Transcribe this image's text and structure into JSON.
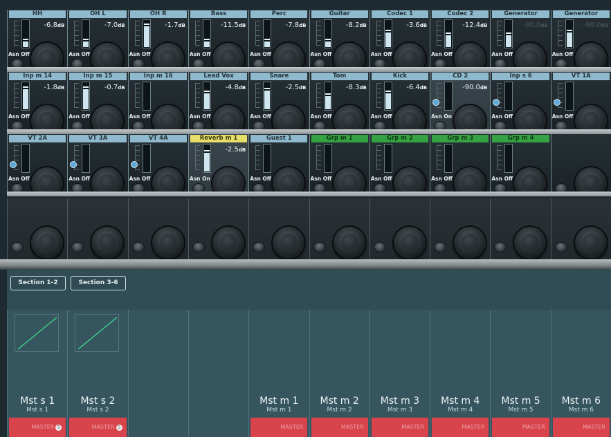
{
  "rows": [
    [
      {
        "name": "HH",
        "value": "-6.8",
        "unit": "dB",
        "asn": "Asn Off",
        "level": 0.22
      },
      {
        "name": "OH L",
        "value": "-7.0",
        "unit": "dB",
        "asn": "Asn Off",
        "level": 0.2
      },
      {
        "name": "OH R",
        "value": "-1.7",
        "unit": "dB",
        "asn": "Asn Off",
        "level": 0.8
      },
      {
        "name": "Bass",
        "value": "-11.5",
        "unit": "dB",
        "asn": "Asn Off",
        "level": 0.2
      },
      {
        "name": "Perc",
        "value": "-7.8",
        "unit": "dB",
        "asn": "Asn Off",
        "level": 0.2
      },
      {
        "name": "Guitar",
        "value": "-8.2",
        "unit": "dB",
        "asn": "Asn Off",
        "level": 0.2
      },
      {
        "name": "Codec 1",
        "value": "-3.6",
        "unit": "dB",
        "asn": "Asn Off",
        "level": 0.55
      },
      {
        "name": "Codec 2",
        "value": "-12.4",
        "unit": "dB",
        "asn": "Asn Off",
        "level": 0.45
      },
      {
        "name": "Generator",
        "value": "-90.0",
        "unit": "dB",
        "asn": "Asn Off",
        "level": 0.45,
        "dim": true
      },
      {
        "name": "Generator",
        "value": "-90.0",
        "unit": "dB",
        "asn": "Asn Off",
        "level": 0.55,
        "dim": true
      }
    ],
    [
      {
        "name": "Inp m 14",
        "value": "-1.8",
        "unit": "dB",
        "asn": "Asn Off",
        "level": 0.75
      },
      {
        "name": "Inp m 15",
        "value": "-0.7",
        "unit": "dB",
        "asn": "Asn Off",
        "level": 0.75
      },
      {
        "name": "Inp m 16",
        "value": "",
        "unit": "",
        "asn": "Asn Off",
        "level": 0
      },
      {
        "name": "Lead Vox",
        "value": "-4.8",
        "unit": "dB",
        "asn": "Asn Off",
        "level": 0.6
      },
      {
        "name": "Snare",
        "value": "-2.5",
        "unit": "dB",
        "asn": "Asn Off",
        "level": 0.7
      },
      {
        "name": "Tom",
        "value": "-8.3",
        "unit": "dB",
        "asn": "Asn Off",
        "level": 0.5
      },
      {
        "name": "Kick",
        "value": "-6.4",
        "unit": "dB",
        "asn": "Asn Off",
        "level": 0.6
      },
      {
        "name": "CD 2",
        "value": "-90.0",
        "unit": "dB",
        "asn": "Asn On",
        "level": 0,
        "link": true,
        "hl": true
      },
      {
        "name": "Inp s 6",
        "value": "",
        "unit": "",
        "asn": "Asn Off",
        "level": 0,
        "link": true
      },
      {
        "name": "VT 1A",
        "value": "",
        "unit": "",
        "asn": "Asn Off",
        "level": 0,
        "link": true
      }
    ],
    [
      {
        "name": "VT 2A",
        "value": "",
        "unit": "",
        "asn": "Asn Off",
        "level": 0,
        "link": true
      },
      {
        "name": "VT 3A",
        "value": "",
        "unit": "",
        "asn": "Asn Off",
        "level": 0,
        "link": true
      },
      {
        "name": "VT 4A",
        "value": "",
        "unit": "",
        "asn": "Asn Off",
        "level": 0,
        "link": true
      },
      {
        "name": "Reverb m 1",
        "value": "-2.5",
        "unit": "dB",
        "asn": "Asn On",
        "level": 0.7,
        "color": "yellow",
        "hl": true
      },
      {
        "name": "Guest 1",
        "value": "",
        "unit": "",
        "asn": "Asn Off",
        "level": 0
      },
      {
        "name": "Grp m 1",
        "value": "",
        "unit": "",
        "asn": "Asn Off",
        "level": 0,
        "color": "green"
      },
      {
        "name": "Grp m 2",
        "value": "",
        "unit": "",
        "asn": "Asn Off",
        "level": 0,
        "color": "green"
      },
      {
        "name": "Grp m 3",
        "value": "",
        "unit": "",
        "asn": "Asn Off",
        "level": 0,
        "color": "green"
      },
      {
        "name": "Grp m 4",
        "value": "",
        "unit": "",
        "asn": "Asn Off",
        "level": 0,
        "color": "green"
      },
      {
        "name": "",
        "value": "",
        "unit": "",
        "asn": "",
        "level": 0,
        "color": "none",
        "empty": true
      }
    ]
  ],
  "tabs": [
    "Section 1-2",
    "Section 3-6"
  ],
  "lanes": [
    {
      "name": "Mst s 1",
      "sub": "Mst s 1",
      "bar": "MASTER",
      "graph": true,
      "solo": "S"
    },
    {
      "name": "Mst s 2",
      "sub": "Mst s 2",
      "bar": "MASTER",
      "graph": true,
      "solo": "S"
    },
    {
      "name": "",
      "sub": "",
      "bar": null
    },
    {
      "name": "",
      "sub": "",
      "bar": null
    },
    {
      "name": "Mst m 1",
      "sub": "Mst m 1",
      "bar": "MASTER"
    },
    {
      "name": "Mst m 2",
      "sub": "Mst m 2",
      "bar": "MASTER"
    },
    {
      "name": "Mst m 3",
      "sub": "Mst m 3",
      "bar": "MASTER"
    },
    {
      "name": "Mst m 4",
      "sub": "Mst m 4",
      "bar": "MASTER"
    },
    {
      "name": "Mst m 5",
      "sub": "Mst m 5",
      "bar": "MASTER"
    },
    {
      "name": "Mst m 6",
      "sub": "Mst m 6",
      "bar": "MASTER"
    }
  ],
  "colors": {
    "header": "#8fb9cc",
    "yellow": "#e7df6a",
    "green": "#35a341",
    "master": "#d9434b",
    "screen": "#34535d"
  }
}
